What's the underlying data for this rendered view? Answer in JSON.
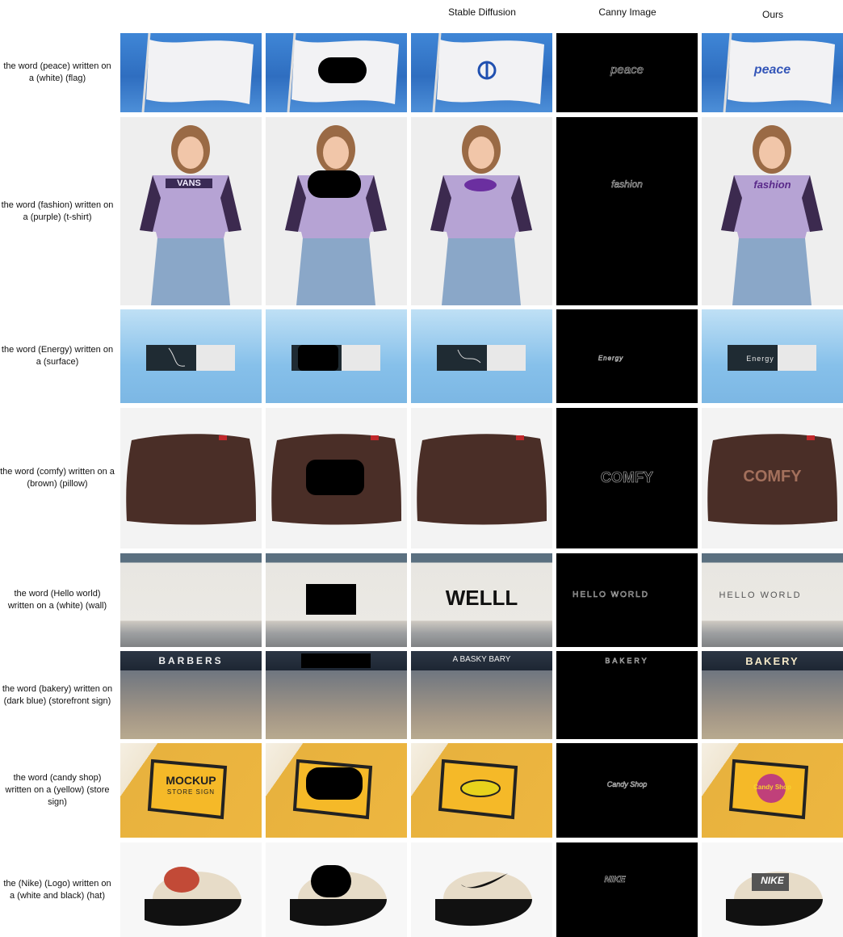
{
  "headers": {
    "col3": "Stable Diffusion",
    "col4": "Canny Image",
    "col5": "Ours"
  },
  "rows": [
    {
      "prompt": "the word (peace) written on a (white) (flag)",
      "canny": "peace",
      "ours": "peace"
    },
    {
      "prompt": "the word (fashion) written on a (purple) (t-shirt)",
      "original_logo": "VANS",
      "canny": "fashion",
      "ours": "fashion"
    },
    {
      "prompt": "the word (Energy) written on a (surface)",
      "canny": "Energy",
      "ours": "Energy"
    },
    {
      "prompt": "the word (comfy) written on a (brown) (pillow)",
      "canny": "COMFY",
      "ours": "COMFY"
    },
    {
      "prompt": "the word (Hello world) written on a (white) (wall)",
      "sd": "WELLL",
      "canny": "HELLO WORLD",
      "ours": "HELLO WORLD"
    },
    {
      "prompt": "the word (bakery) written on (dark blue) (storefront sign)",
      "original_sign": "BARBERS",
      "sd": "A BASKY BARY",
      "canny": "BAKERY",
      "ours": "BAKERY"
    },
    {
      "prompt": "the word (candy shop) written on a (yellow) (store sign)",
      "original_sign": "MOCKUP",
      "original_sub": "STORE SIGN",
      "canny": "Candy Shop",
      "ours": "Candy Shop"
    },
    {
      "prompt": "the (Nike) (Logo) written on a (white and black) (hat)",
      "canny": "NIKE",
      "ours": "NIKE"
    }
  ]
}
